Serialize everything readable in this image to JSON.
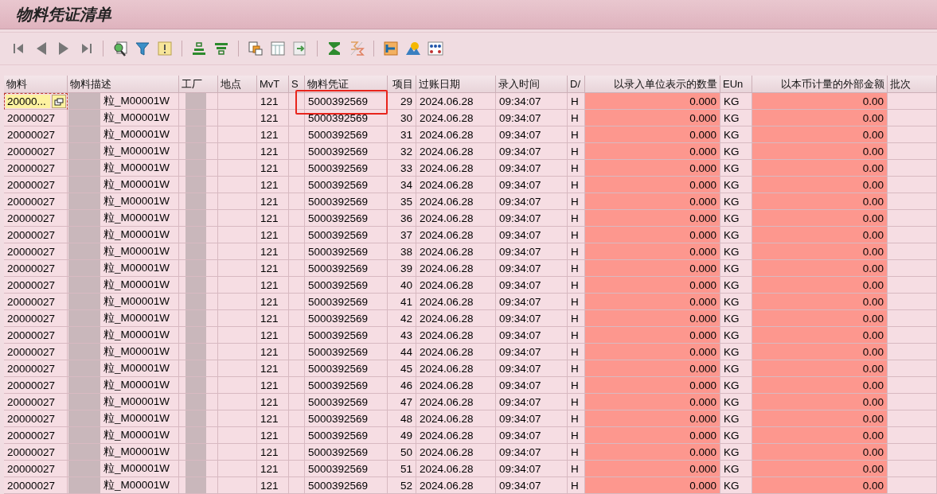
{
  "window": {
    "title": "物料凭证清单"
  },
  "table": {
    "columns": [
      "物料",
      "物料描述",
      "工厂",
      "地点",
      "MvT",
      "S",
      "物料凭证",
      "项目",
      "过账日期",
      "录入时间",
      "D/",
      "以录入单位表示的数量",
      "EUn",
      "以本币计量的外部金额",
      "批次"
    ],
    "rows": [
      {
        "material": "20000...",
        "selected": true,
        "marked": true,
        "description": "粒_M00001W",
        "mvt": "121",
        "document": "5000392569",
        "item": "29",
        "date": "2024.06.28",
        "time": "09:34:07",
        "dc": "H",
        "quantity": "0.000",
        "unit": "KG",
        "amount": "0.00"
      },
      {
        "material": "20000027",
        "selected": false,
        "marked": false,
        "description": "粒_M00001W",
        "mvt": "121",
        "document": "5000392569",
        "item": "30",
        "date": "2024.06.28",
        "time": "09:34:07",
        "dc": "H",
        "quantity": "0.000",
        "unit": "KG",
        "amount": "0.00"
      },
      {
        "material": "20000027",
        "selected": false,
        "marked": false,
        "description": "粒_M00001W",
        "mvt": "121",
        "document": "5000392569",
        "item": "31",
        "date": "2024.06.28",
        "time": "09:34:07",
        "dc": "H",
        "quantity": "0.000",
        "unit": "KG",
        "amount": "0.00"
      },
      {
        "material": "20000027",
        "selected": false,
        "marked": false,
        "description": "粒_M00001W",
        "mvt": "121",
        "document": "5000392569",
        "item": "32",
        "date": "2024.06.28",
        "time": "09:34:07",
        "dc": "H",
        "quantity": "0.000",
        "unit": "KG",
        "amount": "0.00"
      },
      {
        "material": "20000027",
        "selected": false,
        "marked": false,
        "description": "粒_M00001W",
        "mvt": "121",
        "document": "5000392569",
        "item": "33",
        "date": "2024.06.28",
        "time": "09:34:07",
        "dc": "H",
        "quantity": "0.000",
        "unit": "KG",
        "amount": "0.00"
      },
      {
        "material": "20000027",
        "selected": false,
        "marked": false,
        "description": "粒_M00001W",
        "mvt": "121",
        "document": "5000392569",
        "item": "34",
        "date": "2024.06.28",
        "time": "09:34:07",
        "dc": "H",
        "quantity": "0.000",
        "unit": "KG",
        "amount": "0.00"
      },
      {
        "material": "20000027",
        "selected": false,
        "marked": false,
        "description": "粒_M00001W",
        "mvt": "121",
        "document": "5000392569",
        "item": "35",
        "date": "2024.06.28",
        "time": "09:34:07",
        "dc": "H",
        "quantity": "0.000",
        "unit": "KG",
        "amount": "0.00"
      },
      {
        "material": "20000027",
        "selected": false,
        "marked": false,
        "description": "粒_M00001W",
        "mvt": "121",
        "document": "5000392569",
        "item": "36",
        "date": "2024.06.28",
        "time": "09:34:07",
        "dc": "H",
        "quantity": "0.000",
        "unit": "KG",
        "amount": "0.00"
      },
      {
        "material": "20000027",
        "selected": false,
        "marked": false,
        "description": "粒_M00001W",
        "mvt": "121",
        "document": "5000392569",
        "item": "37",
        "date": "2024.06.28",
        "time": "09:34:07",
        "dc": "H",
        "quantity": "0.000",
        "unit": "KG",
        "amount": "0.00"
      },
      {
        "material": "20000027",
        "selected": false,
        "marked": false,
        "description": "粒_M00001W",
        "mvt": "121",
        "document": "5000392569",
        "item": "38",
        "date": "2024.06.28",
        "time": "09:34:07",
        "dc": "H",
        "quantity": "0.000",
        "unit": "KG",
        "amount": "0.00"
      },
      {
        "material": "20000027",
        "selected": false,
        "marked": false,
        "description": "粒_M00001W",
        "mvt": "121",
        "document": "5000392569",
        "item": "39",
        "date": "2024.06.28",
        "time": "09:34:07",
        "dc": "H",
        "quantity": "0.000",
        "unit": "KG",
        "amount": "0.00"
      },
      {
        "material": "20000027",
        "selected": false,
        "marked": false,
        "description": "粒_M00001W",
        "mvt": "121",
        "document": "5000392569",
        "item": "40",
        "date": "2024.06.28",
        "time": "09:34:07",
        "dc": "H",
        "quantity": "0.000",
        "unit": "KG",
        "amount": "0.00"
      },
      {
        "material": "20000027",
        "selected": false,
        "marked": false,
        "description": "粒_M00001W",
        "mvt": "121",
        "document": "5000392569",
        "item": "41",
        "date": "2024.06.28",
        "time": "09:34:07",
        "dc": "H",
        "quantity": "0.000",
        "unit": "KG",
        "amount": "0.00"
      },
      {
        "material": "20000027",
        "selected": false,
        "marked": false,
        "description": "粒_M00001W",
        "mvt": "121",
        "document": "5000392569",
        "item": "42",
        "date": "2024.06.28",
        "time": "09:34:07",
        "dc": "H",
        "quantity": "0.000",
        "unit": "KG",
        "amount": "0.00"
      },
      {
        "material": "20000027",
        "selected": false,
        "marked": false,
        "description": "粒_M00001W",
        "mvt": "121",
        "document": "5000392569",
        "item": "43",
        "date": "2024.06.28",
        "time": "09:34:07",
        "dc": "H",
        "quantity": "0.000",
        "unit": "KG",
        "amount": "0.00"
      },
      {
        "material": "20000027",
        "selected": false,
        "marked": false,
        "description": "粒_M00001W",
        "mvt": "121",
        "document": "5000392569",
        "item": "44",
        "date": "2024.06.28",
        "time": "09:34:07",
        "dc": "H",
        "quantity": "0.000",
        "unit": "KG",
        "amount": "0.00"
      },
      {
        "material": "20000027",
        "selected": false,
        "marked": false,
        "description": "粒_M00001W",
        "mvt": "121",
        "document": "5000392569",
        "item": "45",
        "date": "2024.06.28",
        "time": "09:34:07",
        "dc": "H",
        "quantity": "0.000",
        "unit": "KG",
        "amount": "0.00"
      },
      {
        "material": "20000027",
        "selected": false,
        "marked": false,
        "description": "粒_M00001W",
        "mvt": "121",
        "document": "5000392569",
        "item": "46",
        "date": "2024.06.28",
        "time": "09:34:07",
        "dc": "H",
        "quantity": "0.000",
        "unit": "KG",
        "amount": "0.00"
      },
      {
        "material": "20000027",
        "selected": false,
        "marked": false,
        "description": "粒_M00001W",
        "mvt": "121",
        "document": "5000392569",
        "item": "47",
        "date": "2024.06.28",
        "time": "09:34:07",
        "dc": "H",
        "quantity": "0.000",
        "unit": "KG",
        "amount": "0.00"
      },
      {
        "material": "20000027",
        "selected": false,
        "marked": false,
        "description": "粒_M00001W",
        "mvt": "121",
        "document": "5000392569",
        "item": "48",
        "date": "2024.06.28",
        "time": "09:34:07",
        "dc": "H",
        "quantity": "0.000",
        "unit": "KG",
        "amount": "0.00"
      },
      {
        "material": "20000027",
        "selected": false,
        "marked": false,
        "description": "粒_M00001W",
        "mvt": "121",
        "document": "5000392569",
        "item": "49",
        "date": "2024.06.28",
        "time": "09:34:07",
        "dc": "H",
        "quantity": "0.000",
        "unit": "KG",
        "amount": "0.00"
      },
      {
        "material": "20000027",
        "selected": false,
        "marked": false,
        "description": "粒_M00001W",
        "mvt": "121",
        "document": "5000392569",
        "item": "50",
        "date": "2024.06.28",
        "time": "09:34:07",
        "dc": "H",
        "quantity": "0.000",
        "unit": "KG",
        "amount": "0.00"
      },
      {
        "material": "20000027",
        "selected": false,
        "marked": false,
        "description": "粒_M00001W",
        "mvt": "121",
        "document": "5000392569",
        "item": "51",
        "date": "2024.06.28",
        "time": "09:34:07",
        "dc": "H",
        "quantity": "0.000",
        "unit": "KG",
        "amount": "0.00"
      },
      {
        "material": "20000027",
        "selected": false,
        "marked": false,
        "description": "粒_M00001W",
        "mvt": "121",
        "document": "5000392569",
        "item": "52",
        "date": "2024.06.28",
        "time": "09:34:07",
        "dc": "H",
        "quantity": "0.000",
        "unit": "KG",
        "amount": "0.00"
      }
    ]
  }
}
